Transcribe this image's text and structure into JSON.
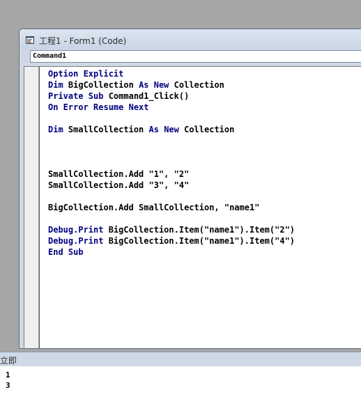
{
  "window": {
    "title": "工程1 - Form1 (Code)",
    "object_combo_value": "Command1"
  },
  "code_lines": [
    [
      {
        "t": "Option Explicit",
        "kw": true
      }
    ],
    [
      {
        "t": "Dim",
        "kw": true
      },
      {
        "t": " BigCollection ",
        "kw": false
      },
      {
        "t": "As New",
        "kw": true
      },
      {
        "t": " Collection",
        "kw": false
      }
    ],
    [
      {
        "t": "Private Sub",
        "kw": true
      },
      {
        "t": " Command1_Click()",
        "kw": false
      }
    ],
    [
      {
        "t": "On Error Resume Next",
        "kw": true
      }
    ],
    [],
    [
      {
        "t": "Dim",
        "kw": true
      },
      {
        "t": " SmallCollection ",
        "kw": false
      },
      {
        "t": "As New",
        "kw": true
      },
      {
        "t": " Collection",
        "kw": false
      }
    ],
    [],
    [],
    [],
    [
      {
        "t": "SmallCollection.Add \"1\", \"2\"",
        "kw": false
      }
    ],
    [
      {
        "t": "SmallCollection.Add \"3\", \"4\"",
        "kw": false
      }
    ],
    [],
    [
      {
        "t": "BigCollection.Add SmallCollection, \"name1\"",
        "kw": false
      }
    ],
    [],
    [
      {
        "t": "Debug.Print",
        "kw": true
      },
      {
        "t": " BigCollection.Item(\"name1\").Item(\"2\")",
        "kw": false
      }
    ],
    [
      {
        "t": "Debug.Print",
        "kw": true
      },
      {
        "t": " BigCollection.Item(\"name1\").Item(\"4\")",
        "kw": false
      }
    ],
    [
      {
        "t": "End Sub",
        "kw": true
      }
    ]
  ],
  "immediate": {
    "title": "立即",
    "lines": [
      "1",
      "3"
    ]
  },
  "colors": {
    "keyword": "#00007f",
    "text": "#000000"
  },
  "icons": {
    "window_icon": "vb-code-window-icon"
  }
}
